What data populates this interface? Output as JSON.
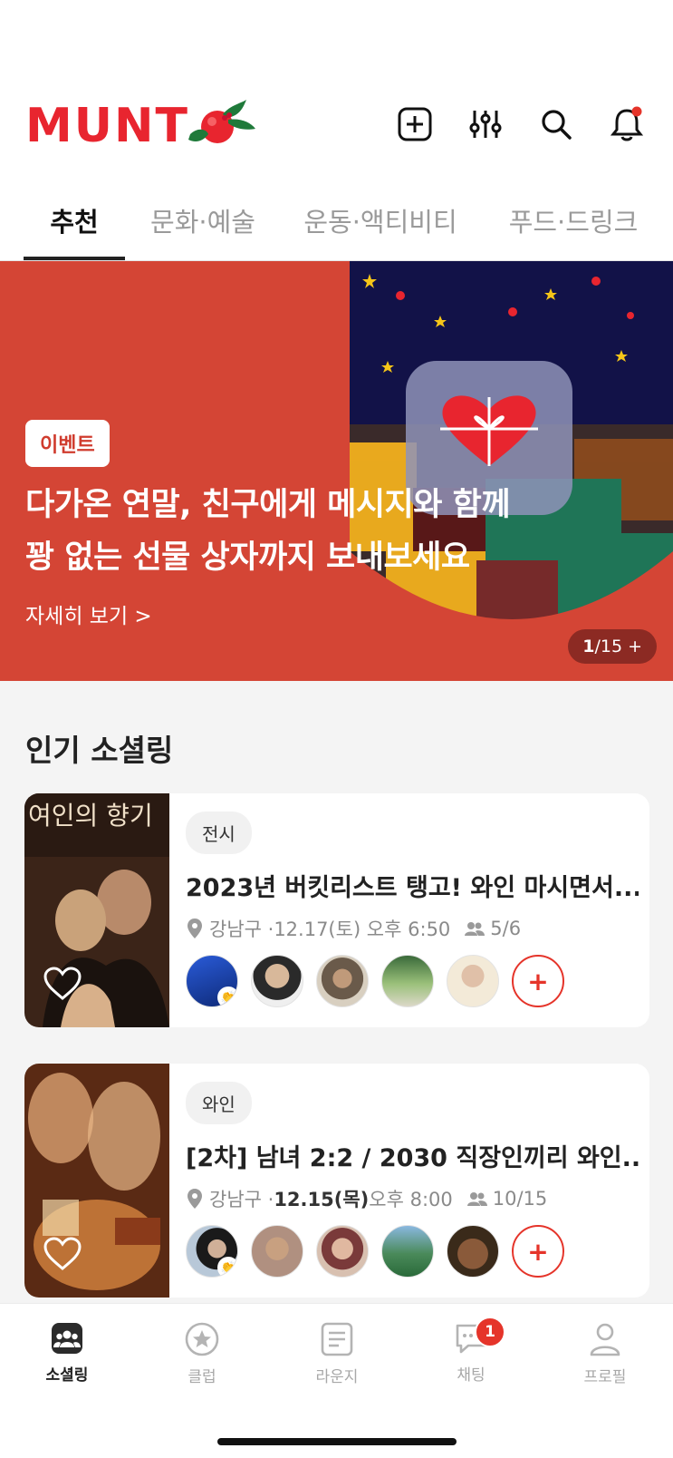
{
  "app": {
    "logo_text": "MUNT"
  },
  "header": {
    "icons": [
      "add-square-icon",
      "filter-sliders-icon",
      "search-icon",
      "bell-icon"
    ],
    "accent": "#e8252f"
  },
  "tabs": [
    {
      "label": "추천",
      "active": true
    },
    {
      "label": "문화·예술",
      "active": false
    },
    {
      "label": "운동·액티비티",
      "active": false
    },
    {
      "label": "푸드·드링크",
      "active": false
    }
  ],
  "banner": {
    "badge": "이벤트",
    "title_line1": "다가온 연말, 친구에게 메시지와 함께",
    "title_line2": "꽝 없는 선물 상자까지 보내보세요",
    "link": "자세히 보기 >",
    "pager_current": "1",
    "pager_rest": "/15 +",
    "bg_color": "#d44535"
  },
  "popular": {
    "title": "인기 소셜링",
    "cards": [
      {
        "category": "전시",
        "title": "2023년 버킷리스트 탱고! 와인 마시면서...",
        "location": "강남구 · ",
        "date": "12.17(토) 오후 6:50",
        "members": "5/6",
        "thumb_text": "여인의 향기"
      },
      {
        "category": "와인",
        "title": "[2차] 남녀 2:2 / 2030 직장인끼리 와인...",
        "location": "강남구 · ",
        "date": "12.15(목)",
        "time": " 오후 8:00",
        "members": "10/15"
      }
    ],
    "plus_label": "+"
  },
  "bottom_nav": [
    {
      "label": "소셜링",
      "icon": "people-icon",
      "active": true
    },
    {
      "label": "클럽",
      "icon": "star-circle-icon",
      "active": false
    },
    {
      "label": "라운지",
      "icon": "document-icon",
      "active": false
    },
    {
      "label": "채팅",
      "icon": "chat-icon",
      "active": false,
      "badge": "1"
    },
    {
      "label": "프로필",
      "icon": "person-icon",
      "active": false
    }
  ]
}
